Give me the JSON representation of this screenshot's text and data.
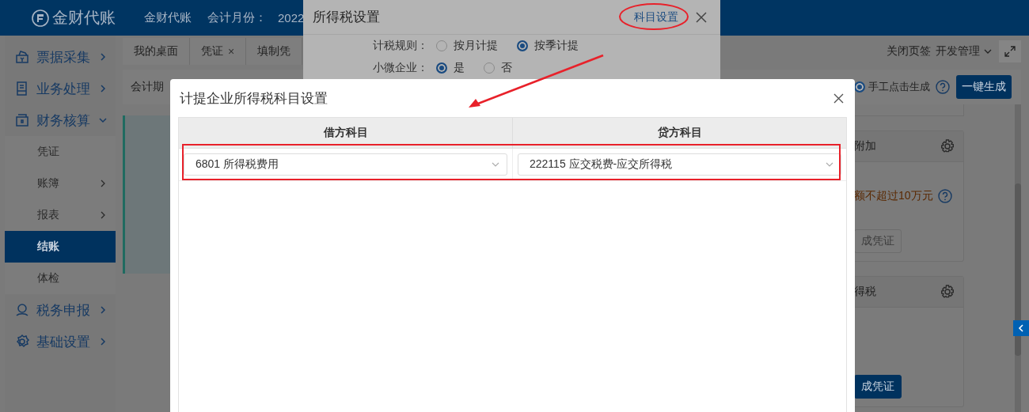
{
  "header": {
    "logo": "金财代账",
    "company": "金财代账",
    "period_label": "会计月份：",
    "period_value": "2022"
  },
  "sidebar": {
    "items": [
      {
        "label": "票据采集",
        "selected": false,
        "expanded": false
      },
      {
        "label": "业务处理",
        "selected": false,
        "expanded": false
      },
      {
        "label": "财务核算",
        "selected": false,
        "expanded": true,
        "children": [
          {
            "label": "凭证",
            "selected": false
          },
          {
            "label": "账簿",
            "selected": false,
            "expanded": false
          },
          {
            "label": "报表",
            "selected": false,
            "expanded": false
          },
          {
            "label": "结账",
            "selected": true
          },
          {
            "label": "体检",
            "selected": false
          }
        ]
      },
      {
        "label": "税务申报",
        "selected": false,
        "expanded": false
      },
      {
        "label": "基础设置",
        "selected": false,
        "expanded": false
      }
    ]
  },
  "tabs": [
    {
      "label": "我的桌面",
      "selected": false
    },
    {
      "label": "凭证",
      "close": "×",
      "selected": false
    },
    {
      "label": "填制凭",
      "selected": false
    }
  ],
  "tab_actions": {
    "close_tabs": "关闭页签",
    "menu": "开发管理"
  },
  "toolbar": {
    "period_label": "会计期",
    "mode_option": {
      "label": "手工点击生成",
      "selected": true
    },
    "generate_button": "一键生成"
  },
  "cards": [
    {
      "title": "附加",
      "note": "额不超过10万元",
      "button": "成凭证",
      "button_disabled": true
    },
    {
      "title": "得税",
      "button": "成凭证",
      "button_disabled": false
    }
  ],
  "tax_dialog": {
    "title": "所得税设置",
    "link": "科目设置",
    "rows": [
      {
        "label": "计税规则：",
        "options": [
          {
            "label": "按月计提",
            "selected": false
          },
          {
            "label": "按季计提",
            "selected": true
          }
        ]
      },
      {
        "label": "小微企业：",
        "options": [
          {
            "label": "是",
            "selected": true
          },
          {
            "label": "否",
            "selected": false
          }
        ]
      }
    ]
  },
  "subject_dialog": {
    "title": "计提企业所得税科目设置",
    "columns": [
      "借方科目",
      "贷方科目"
    ],
    "rows": [
      {
        "cells": [
          "6801 所得税费用",
          "222115 应交税费-应交所得税"
        ]
      }
    ]
  }
}
